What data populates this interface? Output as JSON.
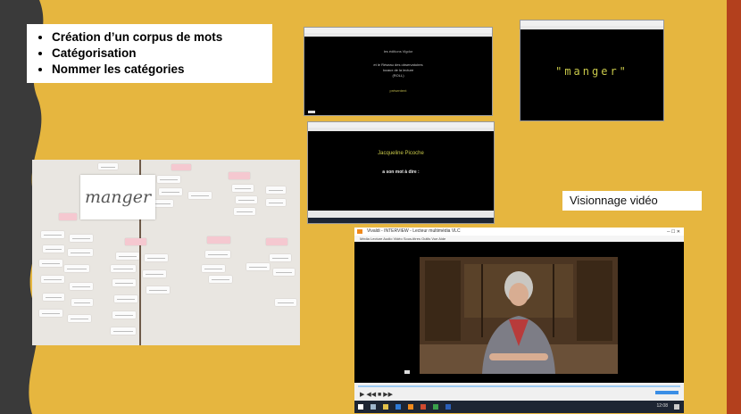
{
  "bullets": [
    "Création d’un corpus de mots",
    "Catégorisation",
    "Nommer les catégories"
  ],
  "photo": {
    "main_word": "manger"
  },
  "video_screens": {
    "screen1": {
      "line1": "les éditions Vigdor",
      "line2": "et le Réseau des observatoires",
      "line3": "locaux de la lecture",
      "line4": "(ROLL)",
      "footer": "présentent"
    },
    "screen2": {
      "word": "\"manger\""
    },
    "screen3": {
      "name": "Jacqueline Picoche",
      "subtitle": "a son mot à dire :"
    }
  },
  "video_label": "Visionnage vidéo",
  "player": {
    "title": "Vivaldi - INTERVIEW - Lecteur multimédia VLC",
    "menu": "Média  Lecture  Audio  Vidéo  Sous-titres  Outils  Vue  Aide",
    "clock_time": "12:08"
  },
  "colors": {
    "background": "#e6b63f",
    "right_stripe": "#b3401d",
    "left_stripe": "#3a3a3a",
    "screen_text_yellow": "#c9c94a"
  }
}
